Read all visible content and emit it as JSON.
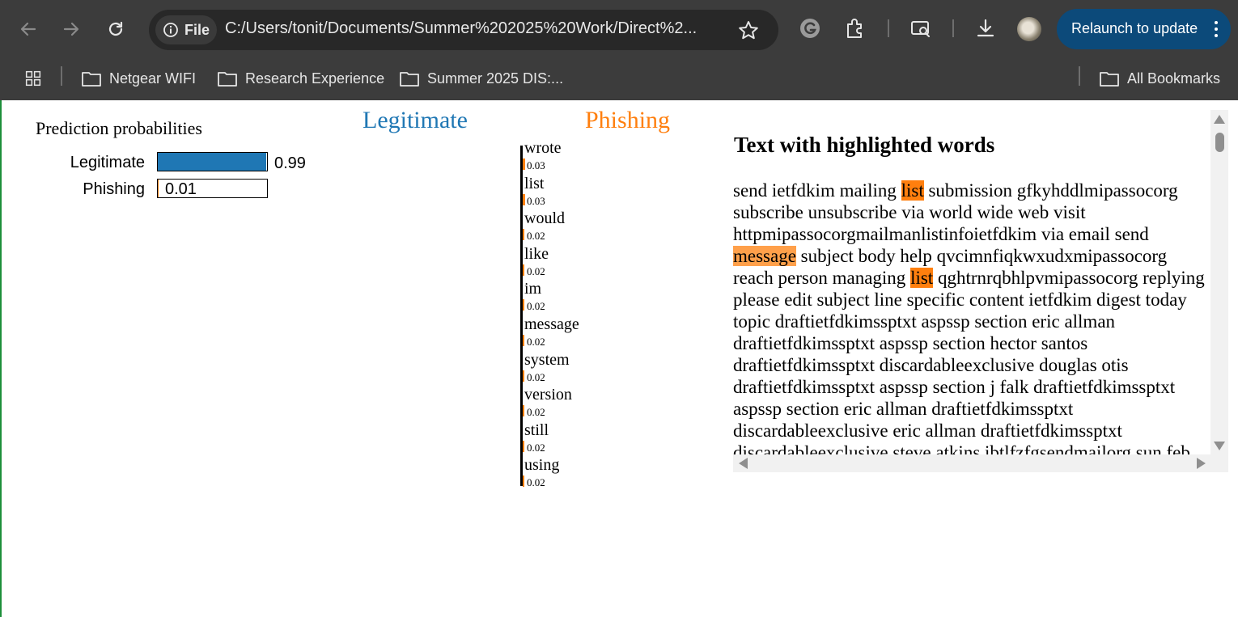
{
  "browser": {
    "url_chip": "File",
    "url": "C:/Users/tonit/Documents/Summer%202025%20Work/Direct%2...",
    "relaunch_label": "Relaunch to update",
    "bookmarks": [
      "Netgear WIFI",
      "Research Experience",
      "Summer 2025 DIS:..."
    ],
    "all_bookmarks": "All Bookmarks"
  },
  "prediction": {
    "title": "Prediction probabilities",
    "classes": [
      {
        "label": "Legitimate",
        "value": "0.99",
        "prob": 0.99,
        "color": "#1f77b4"
      },
      {
        "label": "Phishing",
        "value": "0.01",
        "prob": 0.01,
        "color": "#ff7f0e"
      }
    ]
  },
  "explanation": {
    "left_class": "Legitimate",
    "right_class": "Phishing",
    "left_color": "#1f77b4",
    "right_color": "#ff7f0e",
    "features": [
      {
        "word": "wrote",
        "value": "0.03",
        "weight": 0.03
      },
      {
        "word": "list",
        "value": "0.03",
        "weight": 0.03
      },
      {
        "word": "would",
        "value": "0.02",
        "weight": 0.02
      },
      {
        "word": "like",
        "value": "0.02",
        "weight": 0.02
      },
      {
        "word": "im",
        "value": "0.02",
        "weight": 0.02
      },
      {
        "word": "message",
        "value": "0.02",
        "weight": 0.02
      },
      {
        "word": "system",
        "value": "0.02",
        "weight": 0.02
      },
      {
        "word": "version",
        "value": "0.02",
        "weight": 0.02
      },
      {
        "word": "still",
        "value": "0.02",
        "weight": 0.02
      },
      {
        "word": "using",
        "value": "0.02",
        "weight": 0.02
      }
    ]
  },
  "text_panel": {
    "title": "Text with highlighted words",
    "segments": [
      {
        "t": "send ietfdkim mailing "
      },
      {
        "t": "list",
        "hl": "strong"
      },
      {
        "t": " submission gfkyhddlmipassocorg subscribe unsubscribe via world wide web visit httpmipassocorgmailmanlistinfoietfdkim via email send "
      },
      {
        "t": "message",
        "hl": "mid"
      },
      {
        "t": " subject body help qvcimnfiqkwxudxmipassocorg reach person managing "
      },
      {
        "t": "list",
        "hl": "strong"
      },
      {
        "t": " qghtrnrqbhlpvmipassocorg replying please edit subject line specific content ietfdkim digest today topic draftietfdkimssptxt aspssp section eric allman draftietfdkimssptxt aspssp section hector santos draftietfdkimssptxt discardableexclusive douglas otis draftietfdkimssptxt aspssp section j falk draftietfdkimssptxt aspssp section eric allman draftietfdkimssptxt discardableexclusive eric allman draftietfdkimssptxt discardableexclusive steve atkins ibtlfzfgsendmailorg sun feb"
      }
    ]
  }
}
